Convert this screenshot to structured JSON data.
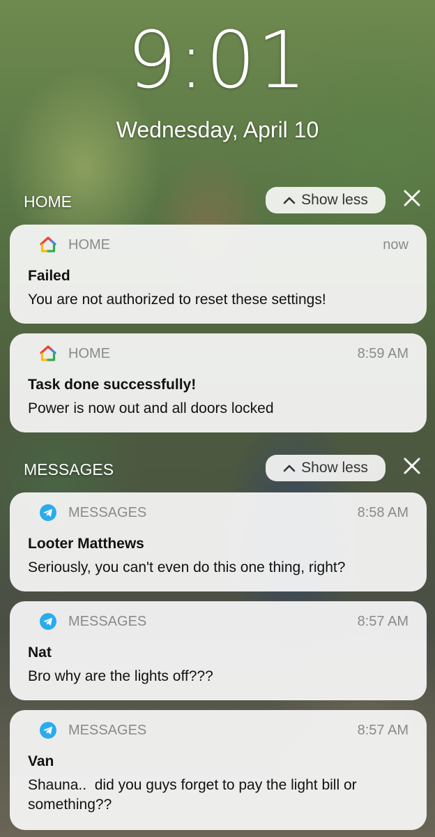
{
  "lockscreen": {
    "time": "9:01",
    "date": "Wednesday, April 10"
  },
  "groups": [
    {
      "title": "HOME",
      "show_less": "Show less",
      "notifications": [
        {
          "app": "HOME",
          "time": "now",
          "title": "Failed",
          "body": "You are not authorized to reset these settings!"
        },
        {
          "app": "HOME",
          "time": "8:59 AM",
          "title": "Task done successfully!",
          "body": "Power is now out and all doors locked"
        }
      ]
    },
    {
      "title": "MESSAGES",
      "show_less": "Show less",
      "notifications": [
        {
          "app": "MESSAGES",
          "time": "8:58 AM",
          "title": "Looter Matthews",
          "body": "Seriously, you can't even do this one thing, right?"
        },
        {
          "app": "MESSAGES",
          "time": "8:57 AM",
          "title": "Nat",
          "body": "Bro why are the lights off???"
        },
        {
          "app": "MESSAGES",
          "time": "8:57 AM",
          "title": "Van",
          "body": "Shauna..  did you guys forget to pay the light bill or something??"
        }
      ]
    }
  ],
  "icons": {
    "home_app": "google-home-icon",
    "messages_app": "telegram-icon",
    "show_less": "chevron-up-icon",
    "dismiss": "close-icon"
  },
  "colors": {
    "telegram": "#2AABEE",
    "home_red": "#EA4335",
    "home_yellow": "#FBBC05",
    "home_green": "#34A853",
    "home_blue": "#4285F4"
  }
}
